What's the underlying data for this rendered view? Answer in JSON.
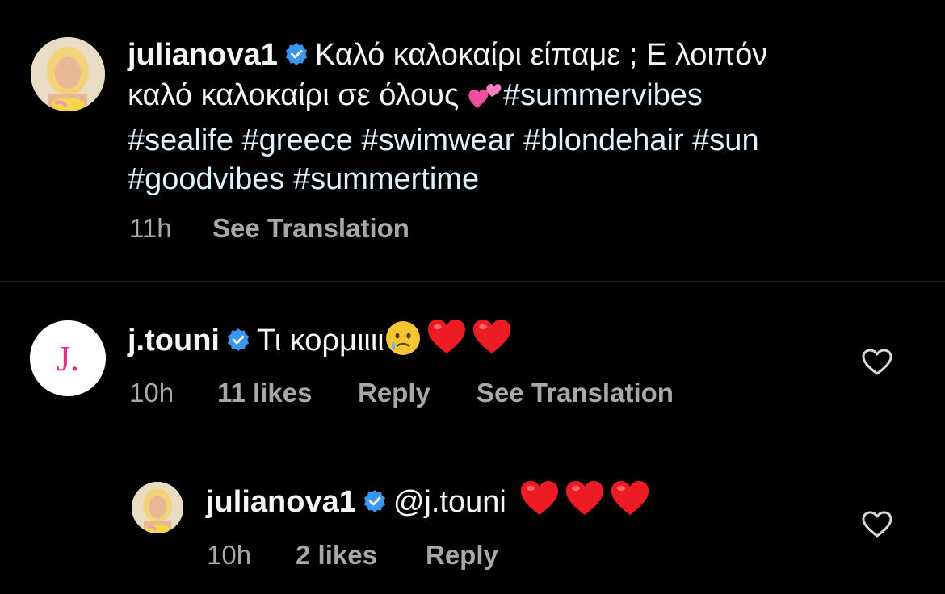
{
  "post": {
    "username": "julianova1",
    "caption_line1": "Καλό καλοκαίρι είπαμε ; Ε λοιπόν",
    "caption_line2_text": "καλό καλοκαίρι σε όλους",
    "caption_line2_tag": "#summervibes",
    "hashtags_line3": "#sealife #greece #swimwear #blondehair #sun",
    "hashtags_line4": "#goodvibes #summertime",
    "time": "11h",
    "see_translation": "See Translation"
  },
  "comments": [
    {
      "username": "j.touni",
      "avatar_letter": "J.",
      "text": "Τι κορμιιιι",
      "time": "10h",
      "likes": "11 likes",
      "reply": "Reply",
      "see_translation": "See Translation"
    },
    {
      "username": "julianova1",
      "text": "@j.touni",
      "time": "10h",
      "likes": "2 likes",
      "reply": "Reply"
    }
  ],
  "icons": {
    "verified": "verified-badge-icon",
    "like": "heart-outline-icon",
    "emoji_hearts": "red-heart-emoji",
    "emoji_cry": "crying-face-emoji",
    "emoji_two_hearts": "two-hearts-emoji"
  },
  "colors": {
    "background": "#000000",
    "text": "#f5f5f5",
    "secondary": "#a8a8a8",
    "verified": "#3897f0",
    "hashtag": "#e0f1ff",
    "heart": "#ed1c24"
  }
}
